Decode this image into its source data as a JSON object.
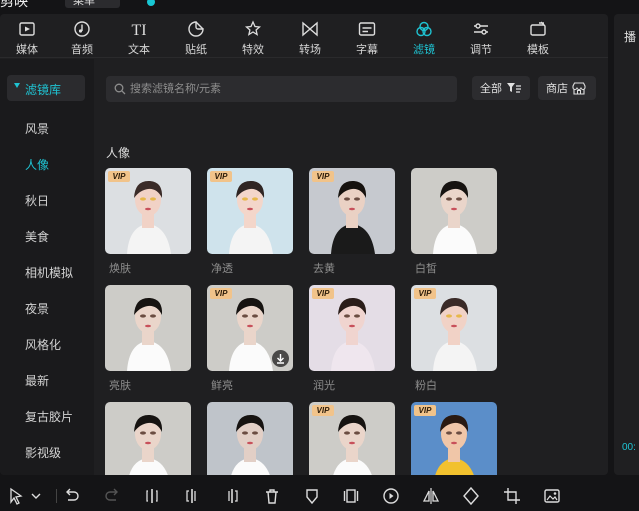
{
  "titlebar": {
    "app_name": "剪映",
    "menu_label": "菜单",
    "project_label": ""
  },
  "tabs": [
    {
      "label": "媒体",
      "icon": "media-icon"
    },
    {
      "label": "音频",
      "icon": "audio-icon"
    },
    {
      "label": "文本",
      "icon": "text-icon"
    },
    {
      "label": "贴纸",
      "icon": "sticker-icon"
    },
    {
      "label": "特效",
      "icon": "effects-icon"
    },
    {
      "label": "转场",
      "icon": "transition-icon"
    },
    {
      "label": "字幕",
      "icon": "subtitle-icon"
    },
    {
      "label": "滤镜",
      "icon": "filter-icon",
      "active": true
    },
    {
      "label": "调节",
      "icon": "adjust-icon"
    },
    {
      "label": "模板",
      "icon": "template-icon"
    }
  ],
  "sidebar": {
    "header": "滤镜库",
    "items": [
      {
        "label": "风景"
      },
      {
        "label": "人像",
        "active": true
      },
      {
        "label": "秋日"
      },
      {
        "label": "美食"
      },
      {
        "label": "相机模拟"
      },
      {
        "label": "夜景"
      },
      {
        "label": "风格化"
      },
      {
        "label": "最新"
      },
      {
        "label": "复古胶片"
      },
      {
        "label": "影视级"
      }
    ]
  },
  "search": {
    "placeholder": "搜索滤镜名称/元素"
  },
  "filter_button": {
    "label": "全部"
  },
  "store_button": {
    "label": "商店"
  },
  "section_title": "人像",
  "filters": [
    {
      "name": "焕肤",
      "vip": true,
      "style": "a"
    },
    {
      "name": "净透",
      "vip": true,
      "style": "a2"
    },
    {
      "name": "去黄",
      "vip": true,
      "style": "b"
    },
    {
      "name": "白皙",
      "vip": false,
      "style": "c"
    },
    {
      "name": "亮肤",
      "vip": false,
      "style": "c"
    },
    {
      "name": "鲜亮",
      "vip": true,
      "style": "c",
      "download": true
    },
    {
      "name": "润光",
      "vip": true,
      "style": "d"
    },
    {
      "name": "粉白",
      "vip": true,
      "style": "a"
    },
    {
      "name": "",
      "vip": false,
      "style": "c"
    },
    {
      "name": "",
      "vip": false,
      "style": "c2"
    },
    {
      "name": "",
      "vip": true,
      "style": "c"
    },
    {
      "name": "",
      "vip": true,
      "style": "e"
    }
  ],
  "vip_badge": "VIP",
  "right_panel": {
    "title": "播",
    "time": "00:"
  },
  "toolbar": [
    "select-arrow-icon",
    "chevron-down-icon",
    "undo-icon",
    "redo-icon",
    "split-icon",
    "split-left-icon",
    "split-right-icon",
    "delete-icon",
    "mark-icon",
    "freeze-icon",
    "play-reverse-icon",
    "mirror-icon",
    "rotate-icon",
    "crop-icon",
    "smart-image-icon"
  ],
  "colors": {
    "accent": "#1fc3d2",
    "vip": "#f1c38a",
    "bg": "#1f1f21"
  }
}
